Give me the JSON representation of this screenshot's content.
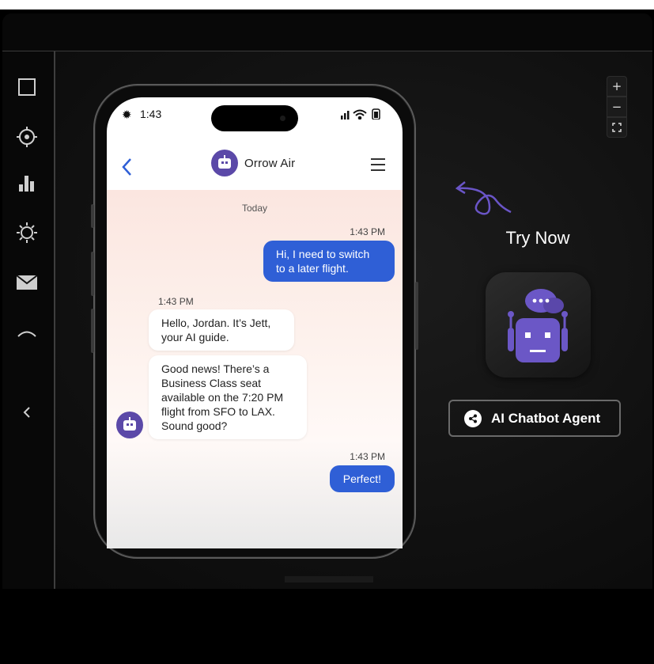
{
  "phone": {
    "status_time": "1:43",
    "app_title": "Orrow Air",
    "day_label": "Today",
    "messages": [
      {
        "time": "1:43 PM",
        "text_1": "Hi, I need to switch",
        "text_2": "to a later flight."
      },
      {
        "time": "1:43 PM",
        "text_1": "Hello, Jordan. It’s Jett,",
        "text_2": "your AI guide."
      },
      {
        "text_1": "Good news! There’s a",
        "text_2": "Business Class seat",
        "text_3": "available on the 7:20 PM",
        "text_4": "flight from SFO to LAX.",
        "text_5": "Sound good?"
      },
      {
        "time": "1:43 PM",
        "text_1": "Perfect!"
      }
    ]
  },
  "panel": {
    "try_now": "Try Now",
    "agent_button": "AI Chatbot Agent"
  },
  "colors": {
    "accent": "#2f5fd6",
    "brand_purple": "#5b49a8",
    "background": "#111111"
  },
  "icons": {
    "sidebar": [
      "square-icon",
      "crosshair-icon",
      "bar-chart-icon",
      "sun-icon",
      "mail-icon",
      "arc-icon",
      "collapse-chevron-icon"
    ],
    "zoom": [
      "plus-icon",
      "minus-icon",
      "fit-screen-icon"
    ]
  }
}
